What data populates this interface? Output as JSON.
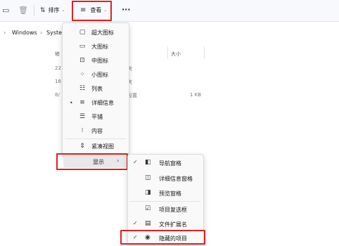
{
  "toolbar": {
    "sort_label": "排序",
    "view_label": "查看",
    "more_label": "···"
  },
  "path": {
    "segments": [
      "Windows",
      "Syster"
    ]
  },
  "columns": {
    "modified": "修",
    "size": "大小"
  },
  "files": [
    {
      "date": "22",
      "type": "夹",
      "size": ""
    },
    {
      "date": "16",
      "type": "夹",
      "size": ""
    },
    {
      "date": "8/",
      "type": "设置",
      "size": "1 KB"
    }
  ],
  "view_menu": {
    "items": [
      {
        "label": "超大图标",
        "icon": "extra-large-icons-icon",
        "glyph": "▢"
      },
      {
        "label": "大图标",
        "icon": "large-icons-icon",
        "glyph": "▭"
      },
      {
        "label": "中图标",
        "icon": "medium-icons-icon",
        "glyph": "⊡"
      },
      {
        "label": "小图标",
        "icon": "small-icons-icon",
        "glyph": "⁘"
      },
      {
        "label": "列表",
        "icon": "list-icon",
        "glyph": "☷"
      },
      {
        "label": "详细信息",
        "icon": "details-icon",
        "glyph": "≡",
        "selected": true
      },
      {
        "label": "平铺",
        "icon": "tiles-icon",
        "glyph": "☰"
      },
      {
        "label": "内容",
        "icon": "content-icon",
        "glyph": "⁝"
      },
      {
        "label": "紧凑视图",
        "icon": "compact-view-icon",
        "glyph": "⇕"
      }
    ],
    "show_label": "显示",
    "selected_dot": "•"
  },
  "show_submenu": {
    "items": [
      {
        "label": "导航窗格",
        "checked": true,
        "icon": "navigation-pane-icon",
        "glyph": "◧"
      },
      {
        "label": "详细信息窗格",
        "checked": false,
        "icon": "details-pane-icon",
        "glyph": "◫"
      },
      {
        "label": "预览窗格",
        "checked": false,
        "icon": "preview-pane-icon",
        "glyph": "◨"
      },
      {
        "label": "项目复选框",
        "checked": false,
        "icon": "item-checkbox-icon",
        "glyph": "☑"
      },
      {
        "label": "文件扩展名",
        "checked": true,
        "icon": "file-extension-icon",
        "glyph": "▤"
      },
      {
        "label": "隐藏的项目",
        "checked": true,
        "icon": "hidden-items-icon",
        "glyph": "◉"
      }
    ],
    "check_glyph": "✓"
  },
  "colors": {
    "highlight": "#e02020"
  }
}
